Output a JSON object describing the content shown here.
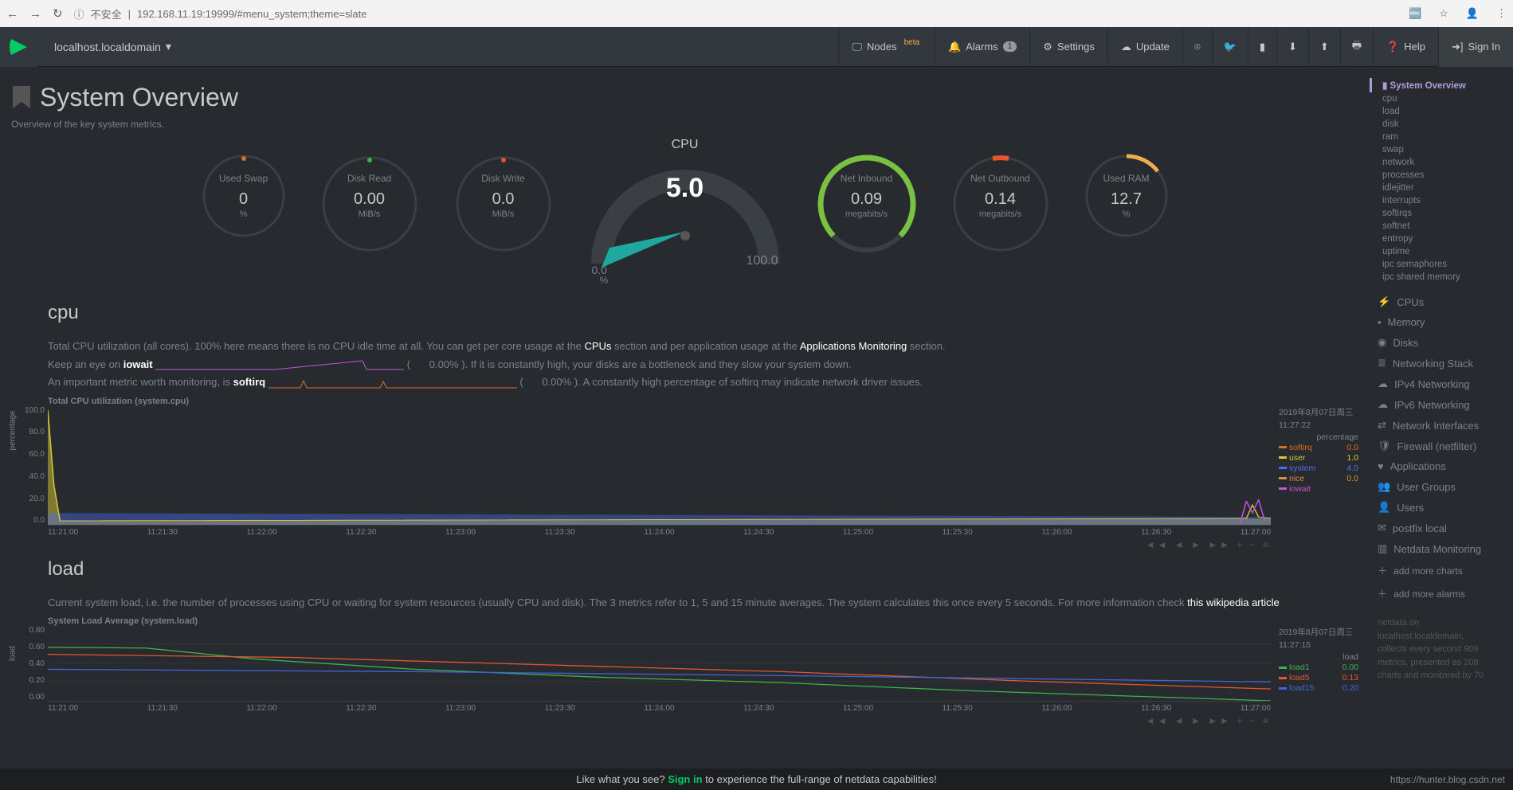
{
  "browser": {
    "insecure": "不安全",
    "url": "192.168.11.19:19999/#menu_system;theme=slate"
  },
  "appbar": {
    "hostname": "localhost.localdomain",
    "nodes": "Nodes",
    "nodes_badge": "beta",
    "alarms": "Alarms",
    "alarms_count": "1",
    "settings": "Settings",
    "update": "Update",
    "help": "Help",
    "signin": "Sign In"
  },
  "page": {
    "title": "System Overview",
    "subtitle": "Overview of the key system metrics."
  },
  "gauges": {
    "used_swap": {
      "label": "Used Swap",
      "value": "0",
      "unit": "%"
    },
    "disk_read": {
      "label": "Disk Read",
      "value": "0.00",
      "unit": "MiB/s"
    },
    "disk_write": {
      "label": "Disk Write",
      "value": "0.0",
      "unit": "MiB/s"
    },
    "cpu": {
      "title": "CPU",
      "value": "5.0",
      "min": "0.0",
      "max": "100.0",
      "pct": "%"
    },
    "net_in": {
      "label": "Net Inbound",
      "value": "0.09",
      "unit": "megabits/s"
    },
    "net_out": {
      "label": "Net Outbound",
      "value": "0.14",
      "unit": "megabits/s"
    },
    "used_ram": {
      "label": "Used RAM",
      "value": "12.7",
      "unit": "%"
    }
  },
  "cpu_section": {
    "heading": "cpu",
    "desc_line1_a": "Total CPU utilization (all cores). 100% here means there is no CPU idle time at all. You can get per core usage at the ",
    "desc_line1_b": "CPUs",
    "desc_line1_c": " section and per application usage at the ",
    "desc_line1_d": "Applications Monitoring",
    "desc_line1_e": " section.",
    "line2_a": "Keep an eye on ",
    "line2_b": "iowait",
    "line2_c": "(",
    "line2_v": "0.00%",
    "line2_d": "). If it is constantly high, your disks are a bottleneck and they slow your system down.",
    "line3_a": "An important metric worth monitoring, is ",
    "line3_b": "softirq",
    "line3_c": "(",
    "line3_v": "0.00%",
    "line3_d": "). A constantly high percentage of softirq may indicate network driver issues.",
    "chart_title": "Total CPU utilization (system.cpu)",
    "timestamp": "2019年8月07日周三",
    "timestamp2": "11:27:22",
    "legend_hdr": "percentage",
    "legend": {
      "softirq": {
        "label": "softirq",
        "value": "0.0",
        "color": "#de6e1f"
      },
      "user": {
        "label": "user",
        "value": "1.0",
        "color": "#d6c836"
      },
      "system": {
        "label": "system",
        "value": "4.0",
        "color": "#4c6ef5"
      },
      "nice": {
        "label": "nice",
        "value": "0.0",
        "color": "#d88c3f"
      },
      "iowait": {
        "label": "iowait",
        "value": "",
        "color": "#c355d9"
      }
    }
  },
  "load_section": {
    "heading": "load",
    "desc_a": "Current system load, i.e. the number of processes using CPU or waiting for system resources (usually CPU and disk). The 3 metrics refer to 1, 5 and 15 minute averages. The system calculates this once every 5 seconds. For more information check ",
    "desc_b": "this wikipedia article",
    "chart_title": "System Load Average (system.load)",
    "timestamp": "2019年8月07日周三",
    "timestamp2": "11:27:15",
    "legend_hdr": "load",
    "legend": {
      "load1": {
        "label": "load1",
        "value": "0.00",
        "color": "#3cb44b"
      },
      "load5": {
        "label": "load5",
        "value": "0.13",
        "color": "#e6552e"
      },
      "load15": {
        "label": "load15",
        "value": "0.20",
        "color": "#4363d8"
      }
    }
  },
  "xaxis": [
    "11:21:00",
    "11:21:30",
    "11:22:00",
    "11:22:30",
    "11:23:00",
    "11:23:30",
    "11:24:00",
    "11:24:30",
    "11:25:00",
    "11:25:30",
    "11:26:00",
    "11:26:30",
    "11:27:00"
  ],
  "yaxis_cpu": [
    "100.0",
    "80.0",
    "60.0",
    "40.0",
    "20.0",
    "0.0"
  ],
  "yaxis_load": [
    "0.80",
    "0.60",
    "0.40",
    "0.20",
    "0.00"
  ],
  "chart_ctrls": "◄◄ ◄ ► ►► + − ≡",
  "right_nav": {
    "active": "System Overview",
    "sub": [
      "cpu",
      "load",
      "disk",
      "ram",
      "swap",
      "network",
      "processes",
      "idlejitter",
      "interrupts",
      "softirqs",
      "softnet",
      "entropy",
      "uptime",
      "ipc semaphores",
      "ipc shared memory"
    ],
    "groups": [
      {
        "icon": "⚡",
        "label": "CPUs"
      },
      {
        "icon": "▪",
        "label": "Memory"
      },
      {
        "icon": "◉",
        "label": "Disks"
      },
      {
        "icon": "≣",
        "label": "Networking Stack"
      },
      {
        "icon": "☁",
        "label": "IPv4 Networking"
      },
      {
        "icon": "☁",
        "label": "IPv6 Networking"
      },
      {
        "icon": "⇄",
        "label": "Network Interfaces"
      },
      {
        "icon": "🛡",
        "label": "Firewall (netfilter)"
      },
      {
        "icon": "♥",
        "label": "Applications"
      },
      {
        "icon": "👥",
        "label": "User Groups"
      },
      {
        "icon": "👤",
        "label": "Users"
      },
      {
        "icon": "✉",
        "label": "postfix local"
      },
      {
        "icon": "▥",
        "label": "Netdata Monitoring"
      }
    ],
    "add_charts": "add more charts",
    "add_alarms": "add more alarms",
    "footer_a": "netdata on",
    "footer_b": "localhost.localdomain,",
    "footer_c": "collects every second 909",
    "footer_d": "metrics, presented as 208",
    "footer_e": "charts and monitored by 70"
  },
  "promo": {
    "a": "Like what you see? ",
    "b": "Sign in",
    "c": " to experience the full-range of netdata capabilities!"
  },
  "watermark": "https://hunter.blog.csdn.net",
  "chart_data": [
    {
      "type": "area",
      "title": "Total CPU utilization (system.cpu)",
      "ylabel": "percentage",
      "ylim": [
        0,
        100
      ],
      "x_ticks": [
        "11:21:00",
        "11:21:30",
        "11:22:00",
        "11:22:30",
        "11:23:00",
        "11:23:30",
        "11:24:00",
        "11:24:30",
        "11:25:00",
        "11:25:30",
        "11:26:00",
        "11:26:30",
        "11:27:00"
      ],
      "series": [
        {
          "name": "softirq",
          "color": "#de6e1f",
          "values": [
            0,
            0,
            0,
            0,
            0,
            0,
            0,
            0,
            0,
            0,
            0,
            0,
            0
          ]
        },
        {
          "name": "user",
          "color": "#d6c836",
          "values": [
            95,
            4,
            3,
            3,
            4,
            3,
            3,
            3,
            3,
            3,
            3,
            3,
            14
          ]
        },
        {
          "name": "system",
          "color": "#4c6ef5",
          "values": [
            5,
            2,
            2,
            2,
            2,
            2,
            2,
            2,
            2,
            2,
            2,
            2,
            6
          ]
        },
        {
          "name": "nice",
          "color": "#d88c3f",
          "values": [
            0,
            0,
            0,
            0,
            0,
            0,
            0,
            0,
            0,
            0,
            0,
            0,
            0
          ]
        },
        {
          "name": "iowait",
          "color": "#c355d9",
          "values": [
            0,
            0,
            0,
            0,
            0,
            0,
            0,
            0,
            0,
            0,
            0,
            0,
            0
          ]
        }
      ]
    },
    {
      "type": "line",
      "title": "System Load Average (system.load)",
      "ylabel": "load",
      "ylim": [
        0,
        0.8
      ],
      "x_ticks": [
        "11:21:00",
        "11:21:30",
        "11:22:00",
        "11:22:30",
        "11:23:00",
        "11:23:30",
        "11:24:00",
        "11:24:30",
        "11:25:00",
        "11:25:30",
        "11:26:00",
        "11:26:30",
        "11:27:00"
      ],
      "series": [
        {
          "name": "load1",
          "color": "#3cb44b",
          "values": [
            0.58,
            0.56,
            0.45,
            0.34,
            0.27,
            0.22,
            0.18,
            0.14,
            0.11,
            0.09,
            0.06,
            0.03,
            0.0
          ]
        },
        {
          "name": "load5",
          "color": "#e6552e",
          "values": [
            0.5,
            0.49,
            0.46,
            0.43,
            0.4,
            0.37,
            0.34,
            0.3,
            0.26,
            0.22,
            0.19,
            0.16,
            0.13
          ]
        },
        {
          "name": "load15",
          "color": "#4363d8",
          "values": [
            0.34,
            0.34,
            0.33,
            0.33,
            0.32,
            0.31,
            0.3,
            0.28,
            0.26,
            0.25,
            0.23,
            0.21,
            0.2
          ]
        }
      ]
    }
  ]
}
